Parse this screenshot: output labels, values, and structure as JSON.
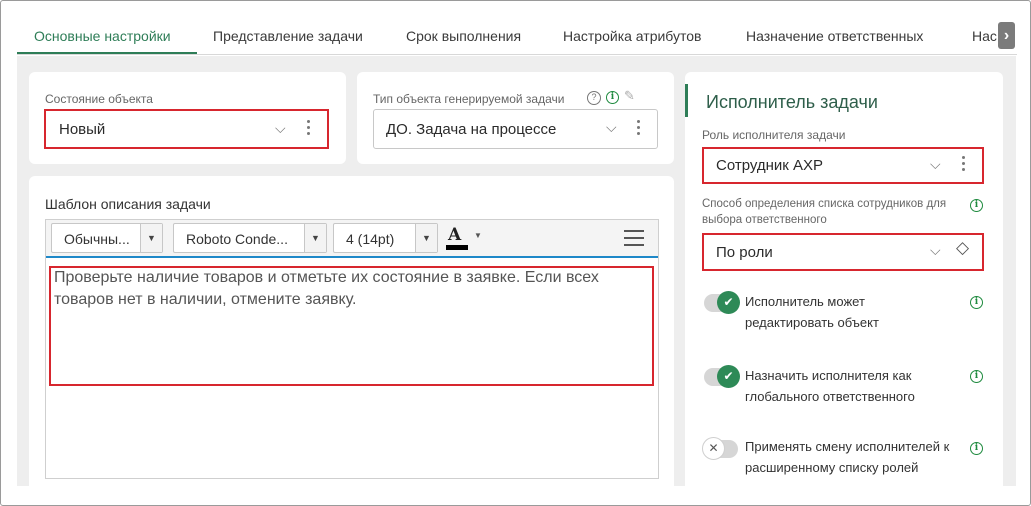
{
  "tabs": [
    {
      "label": "Основные настройки",
      "active": true
    },
    {
      "label": "Представление задачи",
      "active": false
    },
    {
      "label": "Срок выполнения",
      "active": false
    },
    {
      "label": "Настройка атрибутов",
      "active": false
    },
    {
      "label": "Назначение ответственных",
      "active": false
    },
    {
      "label": "Нас",
      "active": false
    }
  ],
  "object_state": {
    "label": "Состояние объекта",
    "value": "Новый"
  },
  "task_type": {
    "label": "Тип объекта генерируемой задачи",
    "value": "ДО. Задача на процессе"
  },
  "description": {
    "label": "Шаблон описания задачи",
    "toolbar": {
      "style": "Обычны...",
      "font": "Roboto Conde...",
      "size": "4 (14pt)",
      "color_letter": "A"
    },
    "text": "Проверьте наличие товаров и отметьте их состояние в заявке. Если всех товаров нет в наличии, отмените заявку."
  },
  "assignee": {
    "title": "Исполнитель задачи",
    "role_label": "Роль исполнителя задачи",
    "role_value": "Сотрудник АХР",
    "method_label": "Способ определения списка сотрудников для выбора ответственного",
    "method_value": "По роли",
    "toggles": [
      {
        "label": "Исполнитель может редактировать объект",
        "on": true
      },
      {
        "label": "Назначить исполнителя как глобального ответственного",
        "on": true
      },
      {
        "label": "Применять смену исполнителей к расширенному списку ролей",
        "on": false
      }
    ]
  },
  "colors": {
    "accent": "#2e7d57",
    "highlight": "#d7262e",
    "info": "#1e8a3e"
  }
}
